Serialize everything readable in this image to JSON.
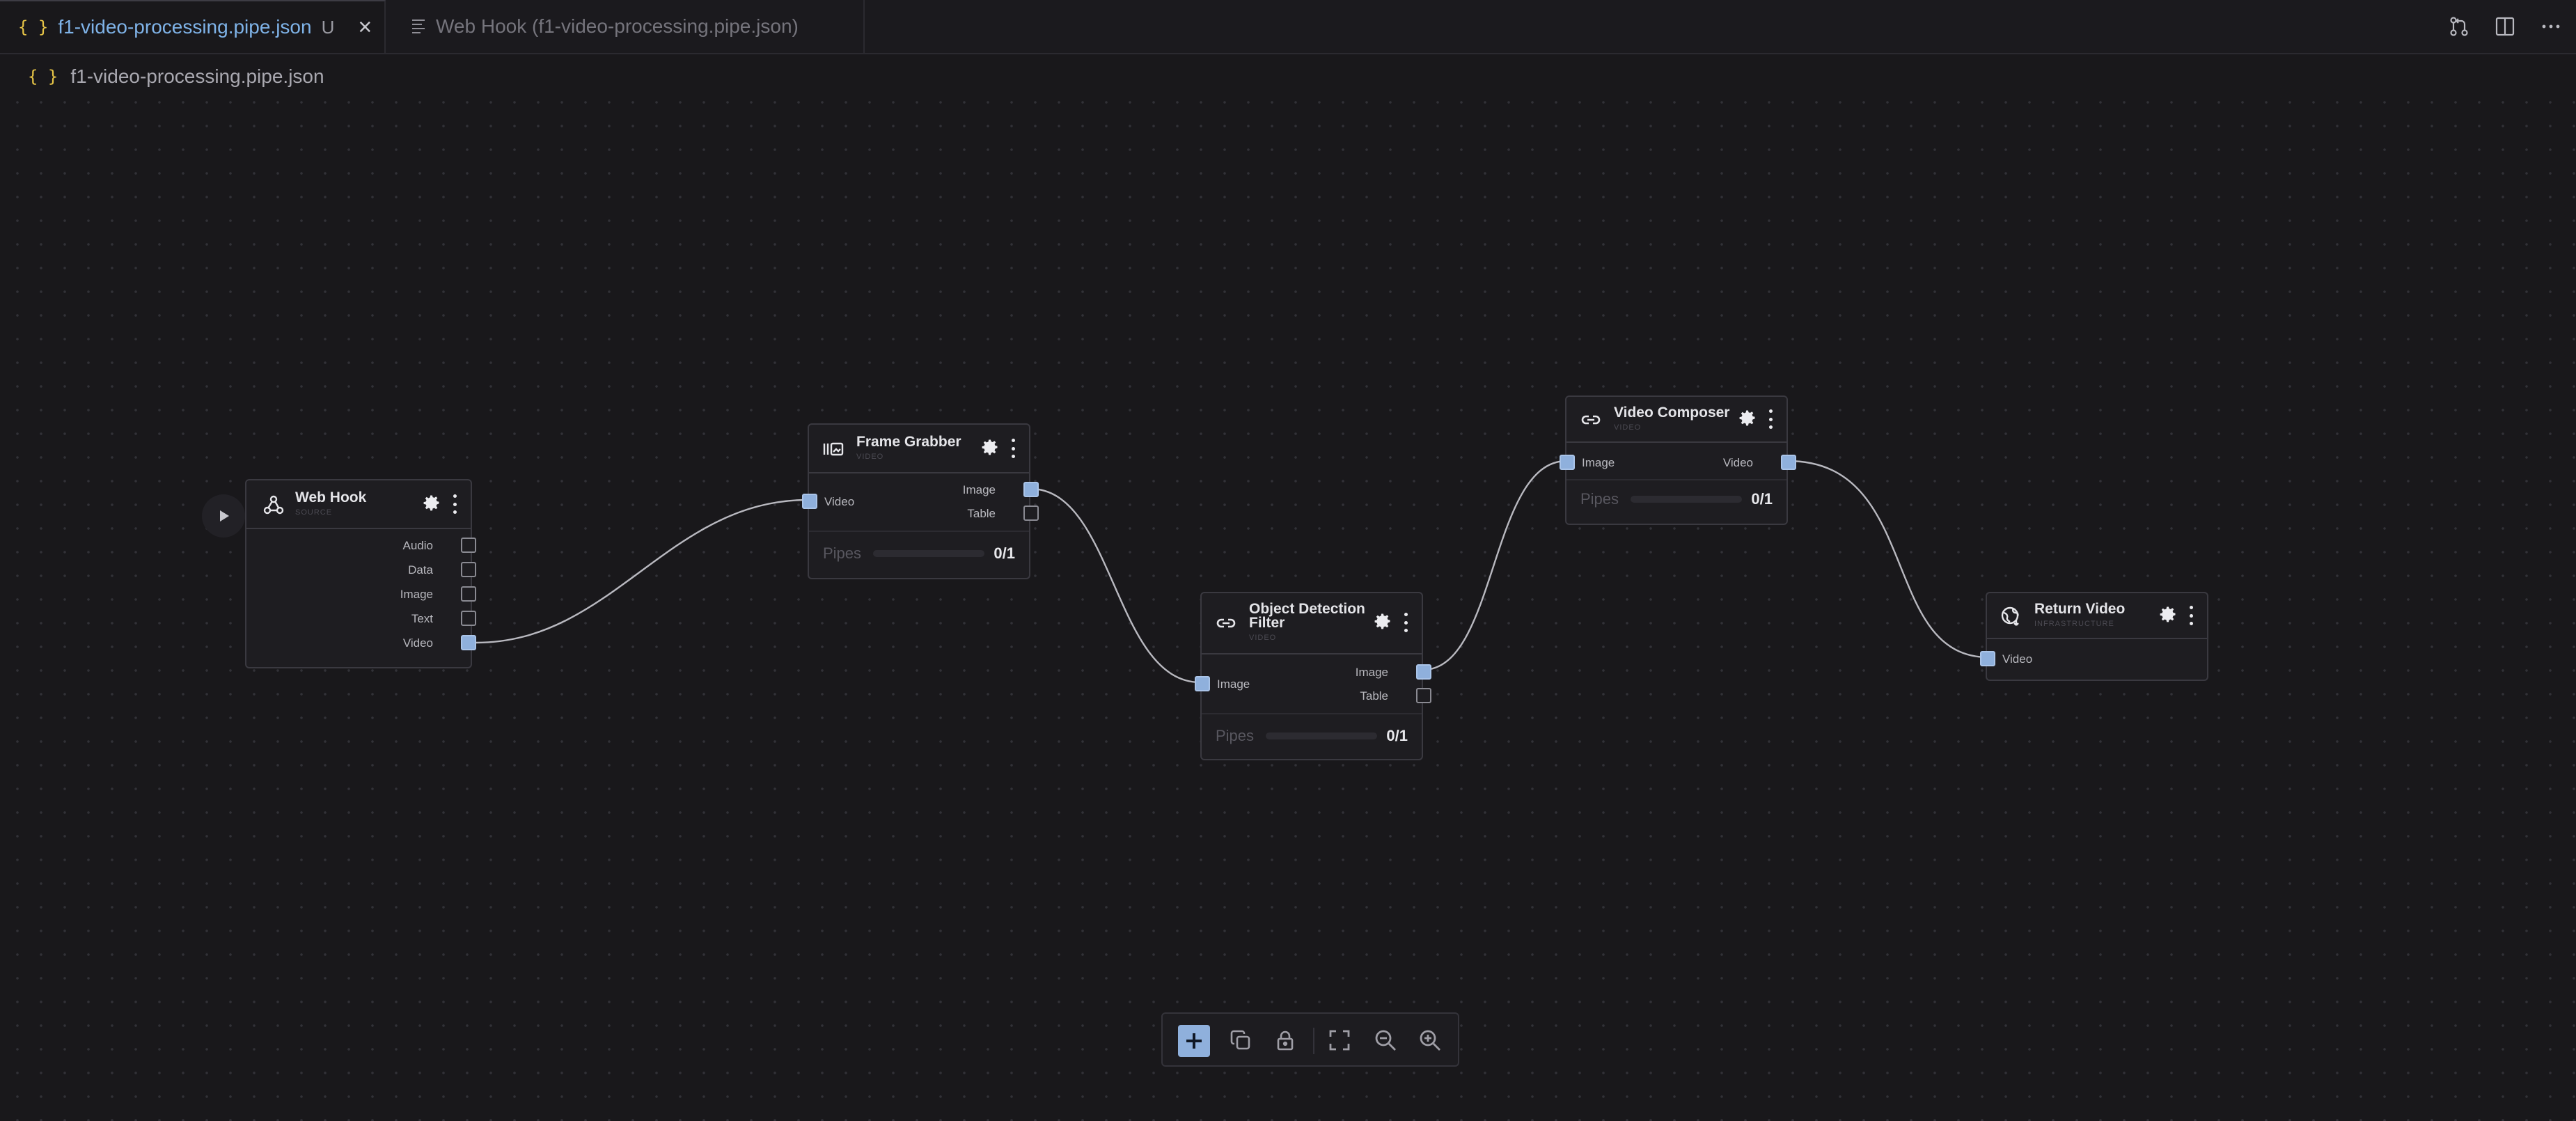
{
  "tabs": [
    {
      "icon": "json-braces-icon",
      "label": "f1-video-processing.pipe.json",
      "status": "U",
      "active": true
    },
    {
      "icon": "lines-icon",
      "label": "Web Hook (f1-video-processing.pipe.json)",
      "active": false
    }
  ],
  "top_actions": [
    "source-control-icon",
    "split-editor-icon",
    "more-icon"
  ],
  "breadcrumb": {
    "icon": "json-braces-icon",
    "label": "f1-video-processing.pipe.json"
  },
  "colors": {
    "port_active": "#8fb0dc",
    "background": "#19181b",
    "accent_file": "#e7c547",
    "active_tab_text": "#7fb3e8"
  },
  "nodes": {
    "webhook": {
      "title": "Web Hook",
      "subtitle": "SOURCE",
      "icon": "webhook-icon",
      "outputs": [
        "Audio",
        "Data",
        "Image",
        "Text",
        "Video"
      ]
    },
    "frame_grabber": {
      "title": "Frame Grabber",
      "subtitle": "VIDEO",
      "icon": "frame-grabber-icon",
      "input": "Video",
      "outputs": [
        "Image",
        "Table"
      ],
      "pipes_label": "Pipes",
      "pipes_value": "0/1"
    },
    "object_detection": {
      "title_line1": "Object Detection",
      "title_line2": "Filter",
      "subtitle": "VIDEO",
      "icon": "link-icon",
      "input": "Image",
      "outputs": [
        "Image",
        "Table"
      ],
      "pipes_label": "Pipes",
      "pipes_value": "0/1"
    },
    "video_composer": {
      "title": "Video Composer",
      "subtitle": "VIDEO",
      "icon": "link-icon",
      "input": "Image",
      "output": "Video",
      "pipes_label": "Pipes",
      "pipes_value": "0/1"
    },
    "return_video": {
      "title": "Return Video",
      "subtitle": "INFRASTRUCTURE",
      "icon": "globe-icon",
      "input": "Video"
    }
  },
  "toolbar": [
    "add-icon",
    "duplicate-icon",
    "lock-icon",
    "fit-view-icon",
    "zoom-out-icon",
    "zoom-in-icon"
  ]
}
